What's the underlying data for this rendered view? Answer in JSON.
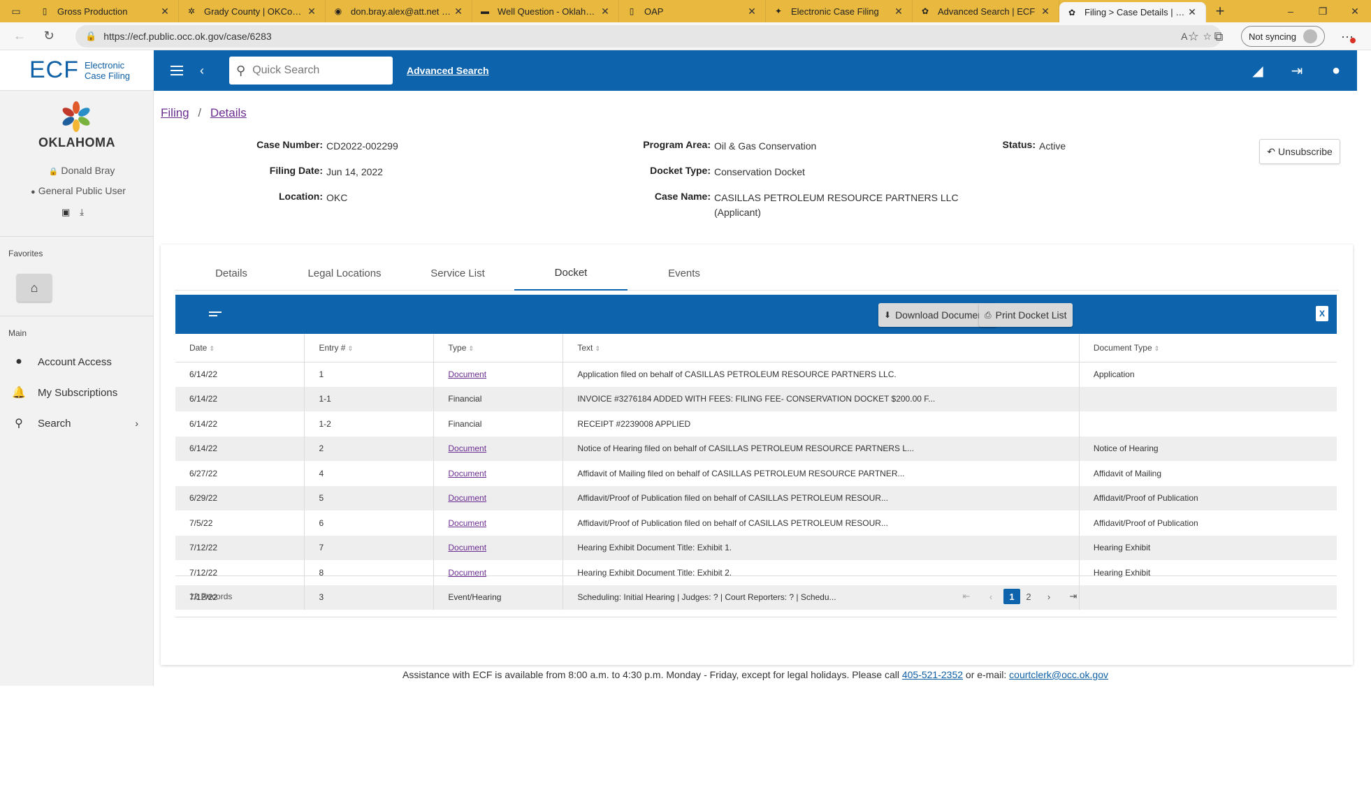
{
  "browser": {
    "tabs": [
      {
        "label": "Gross Production",
        "favicon": "doc-icon",
        "active": false
      },
      {
        "label": "Grady County | OKCountyR",
        "favicon": "gear-icon",
        "active": false
      },
      {
        "label": "don.bray.alex@att.net - AT",
        "favicon": "globe-icon",
        "active": false
      },
      {
        "label": "Well Question - Oklahoma",
        "favicon": "flag-icon",
        "active": false
      },
      {
        "label": "OAP",
        "favicon": "doc-icon",
        "active": false
      },
      {
        "label": "Electronic Case Filing",
        "favicon": "ecf-icon",
        "active": false
      },
      {
        "label": "Advanced Search | ECF",
        "favicon": "seal-icon",
        "active": false
      },
      {
        "label": "Filing > Case Details | ECF",
        "favicon": "seal-icon",
        "active": true
      }
    ],
    "url": "https://ecf.public.occ.ok.gov/case/6283",
    "sync_label": "Not syncing",
    "accent": "#e9b93f"
  },
  "app": {
    "logo_main": "ECF",
    "logo_sub_1": "Electronic",
    "logo_sub_2": "Case Filing",
    "search_placeholder": "Quick Search",
    "advanced_search": "Advanced Search",
    "brand_color": "#0d64ad"
  },
  "sidebar": {
    "state": "OKLAHOMA",
    "user_name": "Donald Bray",
    "user_role": "General Public User",
    "favorites_label": "Favorites",
    "main_label": "Main",
    "items": [
      {
        "label": "Account Access",
        "icon": "account-circle-icon"
      },
      {
        "label": "My Subscriptions",
        "icon": "bell-icon"
      },
      {
        "label": "Search",
        "icon": "search-icon"
      }
    ]
  },
  "breadcrumb": {
    "first": "Filing",
    "sep": "/",
    "second": "Details"
  },
  "case": {
    "case_number_label": "Case Number:",
    "case_number": "CD2022-002299",
    "filing_date_label": "Filing Date:",
    "filing_date": "Jun 14, 2022",
    "location_label": "Location:",
    "location": "OKC",
    "program_area_label": "Program Area:",
    "program_area": "Oil & Gas Conservation",
    "docket_type_label": "Docket Type:",
    "docket_type": "Conservation Docket",
    "case_name_label": "Case Name:",
    "case_name_1": "CASILLAS PETROLEUM RESOURCE PARTNERS LLC",
    "case_name_2": "(Applicant)",
    "status_label": "Status:",
    "status": "Active",
    "unsubscribe": "Unsubscribe"
  },
  "tabs": [
    "Details",
    "Legal Locations",
    "Service List",
    "Docket",
    "Events"
  ],
  "active_tab": "Docket",
  "toolbar": {
    "download": "Download Documents",
    "print": "Print Docket List",
    "excel_glyph": "X"
  },
  "table": {
    "columns": [
      "Date",
      "Entry #",
      "Type",
      "Text",
      "Document Type"
    ],
    "rows": [
      {
        "date": "6/14/22",
        "entry": "1",
        "type": "Document",
        "text": "Application filed on behalf of CASILLAS PETROLEUM RESOURCE PARTNERS LLC.",
        "doc_type": "Application"
      },
      {
        "date": "6/14/22",
        "entry": "1-1",
        "type": "Financial",
        "text": "INVOICE #3276184 ADDED WITH FEES: FILING FEE- CONSERVATION DOCKET $200.00 F...",
        "doc_type": ""
      },
      {
        "date": "6/14/22",
        "entry": "1-2",
        "type": "Financial",
        "text": "RECEIPT #2239008 APPLIED",
        "doc_type": ""
      },
      {
        "date": "6/14/22",
        "entry": "2",
        "type": "Document",
        "text": "Notice of Hearing filed on behalf of CASILLAS PETROLEUM RESOURCE PARTNERS L...",
        "doc_type": "Notice of Hearing"
      },
      {
        "date": "6/27/22",
        "entry": "4",
        "type": "Document",
        "text": "Affidavit of Mailing filed on behalf of CASILLAS PETROLEUM RESOURCE PARTNER...",
        "doc_type": "Affidavit of Mailing"
      },
      {
        "date": "6/29/22",
        "entry": "5",
        "type": "Document",
        "text": "Affidavit/Proof of Publication filed on behalf of CASILLAS PETROLEUM RESOUR...",
        "doc_type": "Affidavit/Proof of Publication"
      },
      {
        "date": "7/5/22",
        "entry": "6",
        "type": "Document",
        "text": "Affidavit/Proof of Publication filed on behalf of CASILLAS PETROLEUM RESOUR...",
        "doc_type": "Affidavit/Proof of Publication"
      },
      {
        "date": "7/12/22",
        "entry": "7",
        "type": "Document",
        "text": "Hearing Exhibit Document Title: Exhibit 1.",
        "doc_type": "Hearing Exhibit"
      },
      {
        "date": "7/12/22",
        "entry": "8",
        "type": "Document",
        "text": "Hearing Exhibit Document Title: Exhibit 2.",
        "doc_type": "Hearing Exhibit"
      },
      {
        "date": "7/12/22",
        "entry": "3",
        "type": "Event/Hearing",
        "text": "Scheduling: Initial Hearing | Judges: ? | Court Reporters: ? | Schedu...",
        "doc_type": ""
      }
    ]
  },
  "pagination": {
    "records": "12 Records",
    "pages": [
      "1",
      "2"
    ],
    "current": "1"
  },
  "footer": {
    "text": "Assistance with ECF is available from 8:00 a.m. to 4:30 p.m. Monday - Friday, except for legal holidays. Please call",
    "phone": "405-521-2352",
    "mid": "or e-mail:",
    "email": "courtclerk@occ.ok.gov"
  }
}
